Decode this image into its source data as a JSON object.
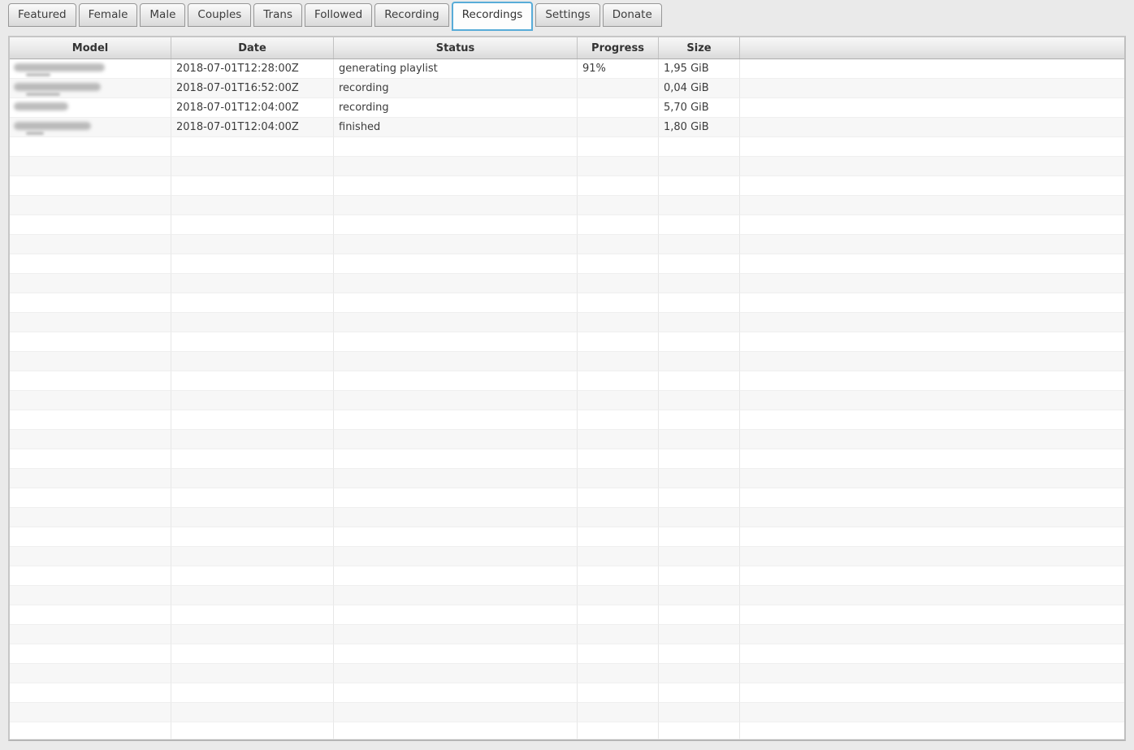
{
  "tab_bar": {
    "tabs": [
      {
        "label": "Featured",
        "active": false
      },
      {
        "label": "Female",
        "active": false
      },
      {
        "label": "Male",
        "active": false
      },
      {
        "label": "Couples",
        "active": false
      },
      {
        "label": "Trans",
        "active": false
      },
      {
        "label": "Followed",
        "active": false
      },
      {
        "label": "Recording",
        "active": false
      },
      {
        "label": "Recordings",
        "active": true
      },
      {
        "label": "Settings",
        "active": false
      },
      {
        "label": "Donate",
        "active": false
      }
    ]
  },
  "table": {
    "columns": [
      "Model",
      "Date",
      "Status",
      "Progress",
      "Size",
      ""
    ],
    "rows": [
      {
        "model_redacted": true,
        "blur_main_width": 112,
        "blur_sub_width": 30,
        "date": "2018-07-01T12:28:00Z",
        "status": "generating playlist",
        "progress": "91%",
        "size": "1,95 GiB"
      },
      {
        "model_redacted": true,
        "blur_main_width": 107,
        "blur_sub_width": 42,
        "date": "2018-07-01T16:52:00Z",
        "status": "recording",
        "progress": "",
        "size": "0,04 GiB"
      },
      {
        "model_redacted": true,
        "blur_main_width": 67,
        "blur_sub_width": 0,
        "date": "2018-07-01T12:04:00Z",
        "status": "recording",
        "progress": "",
        "size": "5,70 GiB"
      },
      {
        "model_redacted": true,
        "blur_main_width": 95,
        "blur_sub_width": 22,
        "date": "2018-07-01T12:04:00Z",
        "status": "finished",
        "progress": "",
        "size": "1,80 GiB"
      }
    ],
    "empty_row_count": 31
  },
  "colors": {
    "active_tab_border": "#58acd8",
    "row_alt_background": "#f7f7f7",
    "header_text": "#333333",
    "cell_text": "#3c3c3c",
    "page_background": "#eaeaea"
  }
}
